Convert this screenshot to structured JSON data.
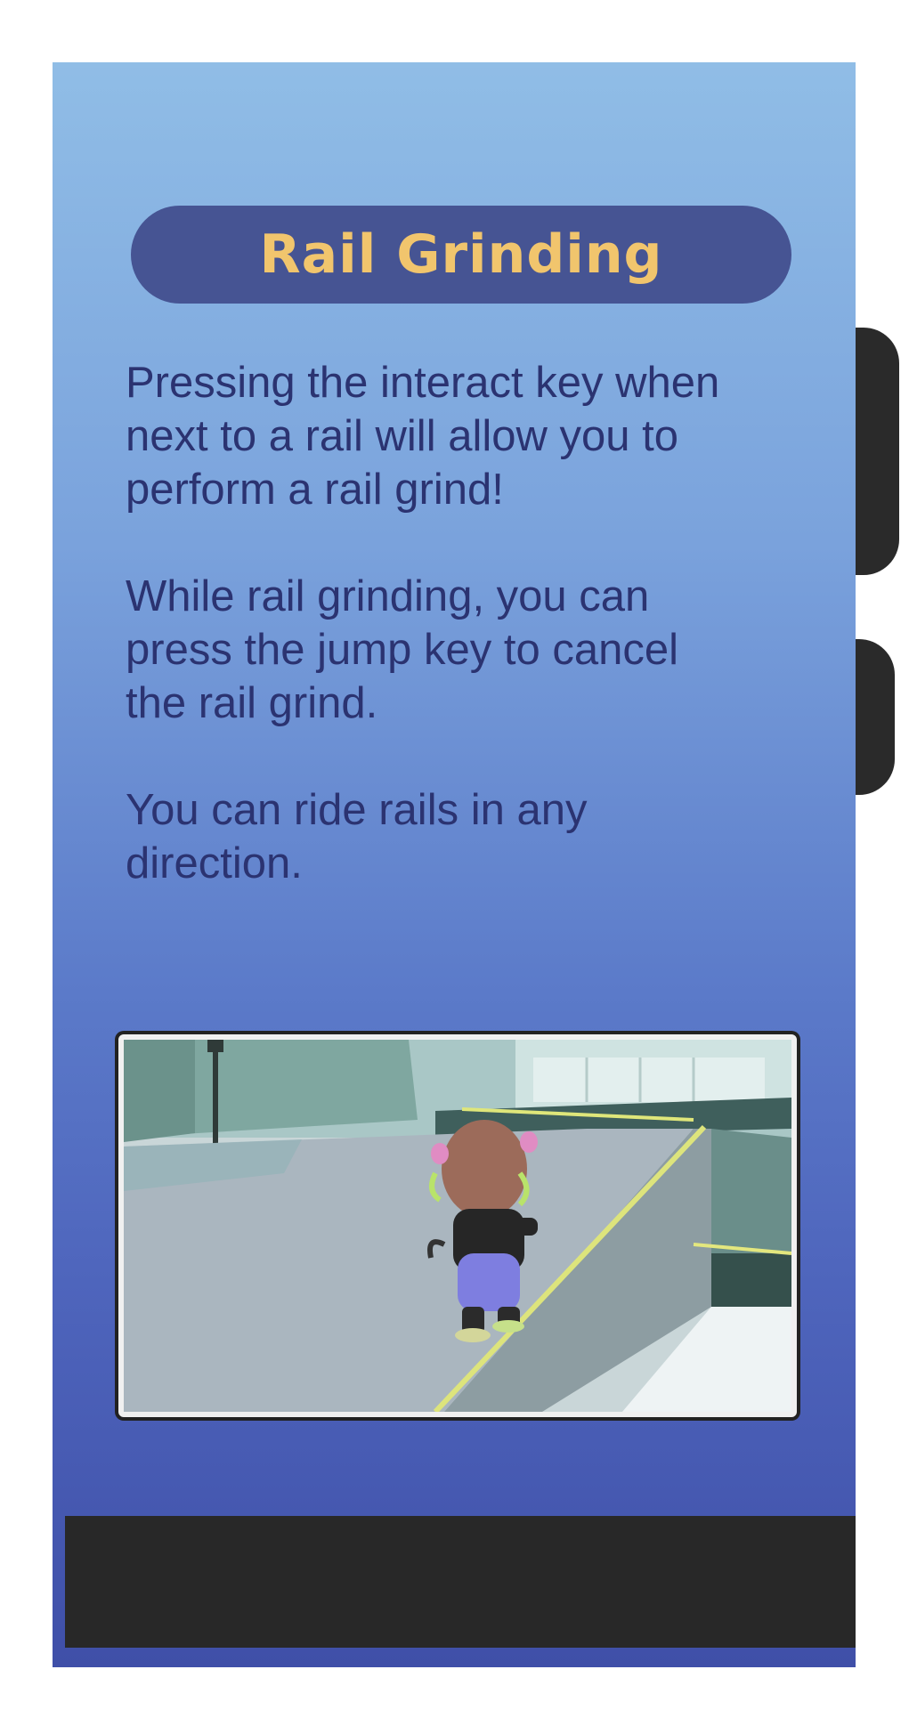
{
  "tutorial": {
    "title": "Rail Grinding",
    "paragraphs": [
      "Pressing the interact key when\nnext to a rail will allow you to\nperform a rail grind!",
      "While rail grinding, you can\npress the jump key to cancel\nthe rail grind.",
      "You can ride rails in any\ndirection."
    ]
  },
  "colors": {
    "title_bg": "#465493",
    "title_text": "#f1c56d",
    "body_text": "#2b3371",
    "panel_top": "#90bde6",
    "panel_bottom": "#3f4fa8",
    "dark_bar": "#282828"
  }
}
